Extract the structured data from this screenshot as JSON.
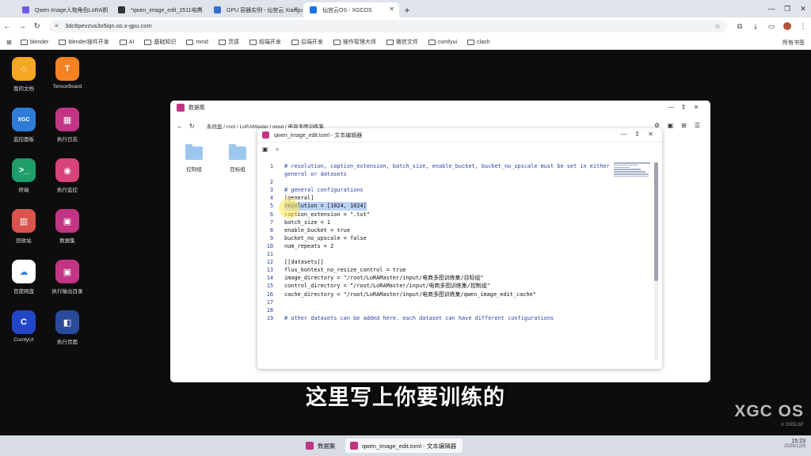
{
  "browser": {
    "tabs": [
      {
        "title": "Qwen Image人物角色LoRA训",
        "color": "#6b5ce7",
        "active": false
      },
      {
        "title": "*qwen_image_edit_2511电商",
        "color": "#333333",
        "active": false
      },
      {
        "title": "GPU 容器实例 - 仙宫云 Xiangu",
        "color": "#2f6fd6",
        "active": false
      },
      {
        "title": "仙宫云OS - XGCOS",
        "color": "#1a73e8",
        "active": true
      }
    ],
    "new_tab": "+",
    "url": "3dc8pevzva3o5iqn.os.x-gpu.com",
    "bookmarks": [
      "blender",
      "blender插件开发",
      "AI",
      "基础知识",
      "mmd",
      "灵感",
      "前端开发",
      "后端开发",
      "操作管理大师",
      "微信文件",
      "comfyui",
      "clash"
    ],
    "bookmarks_right": "所有书签"
  },
  "desktop_icons": [
    {
      "label": "我的文档",
      "color": "#f5a623",
      "glyph": "⌂"
    },
    {
      "label": "TensorBoard",
      "color": "#f58220",
      "glyph": "T"
    },
    {
      "label": "监控面板",
      "color": "#2f7cd8",
      "glyph": "XGC"
    },
    {
      "label": "执行日志",
      "color": "#c13584",
      "glyph": "▦"
    },
    {
      "label": "终端",
      "color": "#1f9d6b",
      "glyph": ">_"
    },
    {
      "label": "执行监控",
      "color": "#d8437a",
      "glyph": "◉"
    },
    {
      "label": "回收站",
      "color": "#d9534f",
      "glyph": "▥"
    },
    {
      "label": "数据集",
      "color": "#c13584",
      "glyph": "▣"
    },
    {
      "label": "百度网盘",
      "color": "#ffffff",
      "glyph": "☁"
    },
    {
      "label": "执行输出目录",
      "color": "#c13584",
      "glyph": "▣"
    },
    {
      "label": "ComfyUI",
      "color": "#2346c9",
      "glyph": "C"
    },
    {
      "label": "执行页面",
      "color": "#2a4a9a",
      "glyph": "◧"
    }
  ],
  "file_manager": {
    "title": "数据集",
    "path": "系统盘 / root / LoRAMaster / input / 电商多图训练集",
    "folders": [
      "控制组",
      "目标组"
    ]
  },
  "editor": {
    "title": "qwen_image_edit.toml - 文本编辑器",
    "lines": [
      {
        "n": "1",
        "t": "# resolution, caption_extension, batch_size, enable_bucket, bucket_no_upscale must be set in either",
        "c": true
      },
      {
        "n": "",
        "t": "general or datasets",
        "c": true
      },
      {
        "n": "2",
        "t": "",
        "c": false
      },
      {
        "n": "3",
        "t": "# general configurations",
        "c": true
      },
      {
        "n": "4",
        "t": "[general]",
        "c": false
      },
      {
        "n": "5",
        "t": "resolution = [1024, 1024]",
        "c": false,
        "sel": true
      },
      {
        "n": "6",
        "t": "caption_extension = \".txt\"",
        "c": false
      },
      {
        "n": "7",
        "t": "batch_size = 1",
        "c": false
      },
      {
        "n": "8",
        "t": "enable_bucket = true",
        "c": false
      },
      {
        "n": "9",
        "t": "bucket_no_upscale = false",
        "c": false
      },
      {
        "n": "10",
        "t": "num_repeats = 2",
        "c": false
      },
      {
        "n": "11",
        "t": "",
        "c": false
      },
      {
        "n": "12",
        "t": "[[datasets]]",
        "c": false
      },
      {
        "n": "13",
        "t": "flux_kontext_no_resize_control = true",
        "c": false
      },
      {
        "n": "14",
        "t": "image_directory = \"/root/LoRAMaster/input/电商多图训练集/目标组\"",
        "c": false
      },
      {
        "n": "15",
        "t": "control_directory = \"/root/LoRAMaster/input/电商多图训练集/控制组\"",
        "c": false
      },
      {
        "n": "16",
        "t": "cache_directory = \"/root/LoRAMaster/input/电商多图训练集/qwen_image_edit_cache\"",
        "c": false
      },
      {
        "n": "17",
        "t": "",
        "c": false
      },
      {
        "n": "18",
        "t": "",
        "c": false
      },
      {
        "n": "19",
        "t": "# other datasets can be added here. each dataset can have different configurations",
        "c": true
      }
    ]
  },
  "subtitle": "这里写上你要训练的",
  "brand": {
    "name": "XGC OS",
    "id": "# O95L6F"
  },
  "taskbar": {
    "items": [
      "数据集",
      "qwen_image_edit.toml - 文本编辑器"
    ],
    "time": "15:23",
    "date": "2025/12/9"
  }
}
